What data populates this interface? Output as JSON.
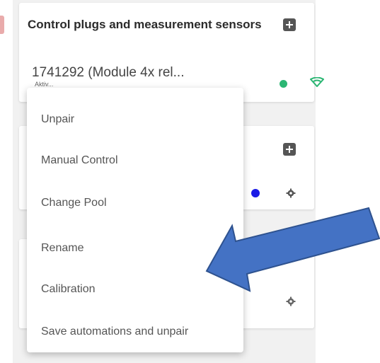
{
  "card1": {
    "title": "Control plugs and measurement sensors",
    "device_name": "1741292 (Module 4x rel...",
    "device_sub": "Aktiv...",
    "status_color": "#2bb673",
    "wifi_color": "#2bb673"
  },
  "card2": {
    "status_color": "#1a1ae6"
  },
  "menu": {
    "items": [
      {
        "label": "Unpair"
      },
      {
        "label": "Manual Control"
      },
      {
        "label": "Change Pool"
      },
      {
        "label": "Rename"
      },
      {
        "label": "Calibration"
      },
      {
        "label": "Save automations and unpair"
      }
    ]
  },
  "arrow": {
    "color": "#4472c4"
  },
  "icons": {
    "add": "plus-square-icon",
    "gear": "gear-icon",
    "wifi": "wifi-icon"
  }
}
